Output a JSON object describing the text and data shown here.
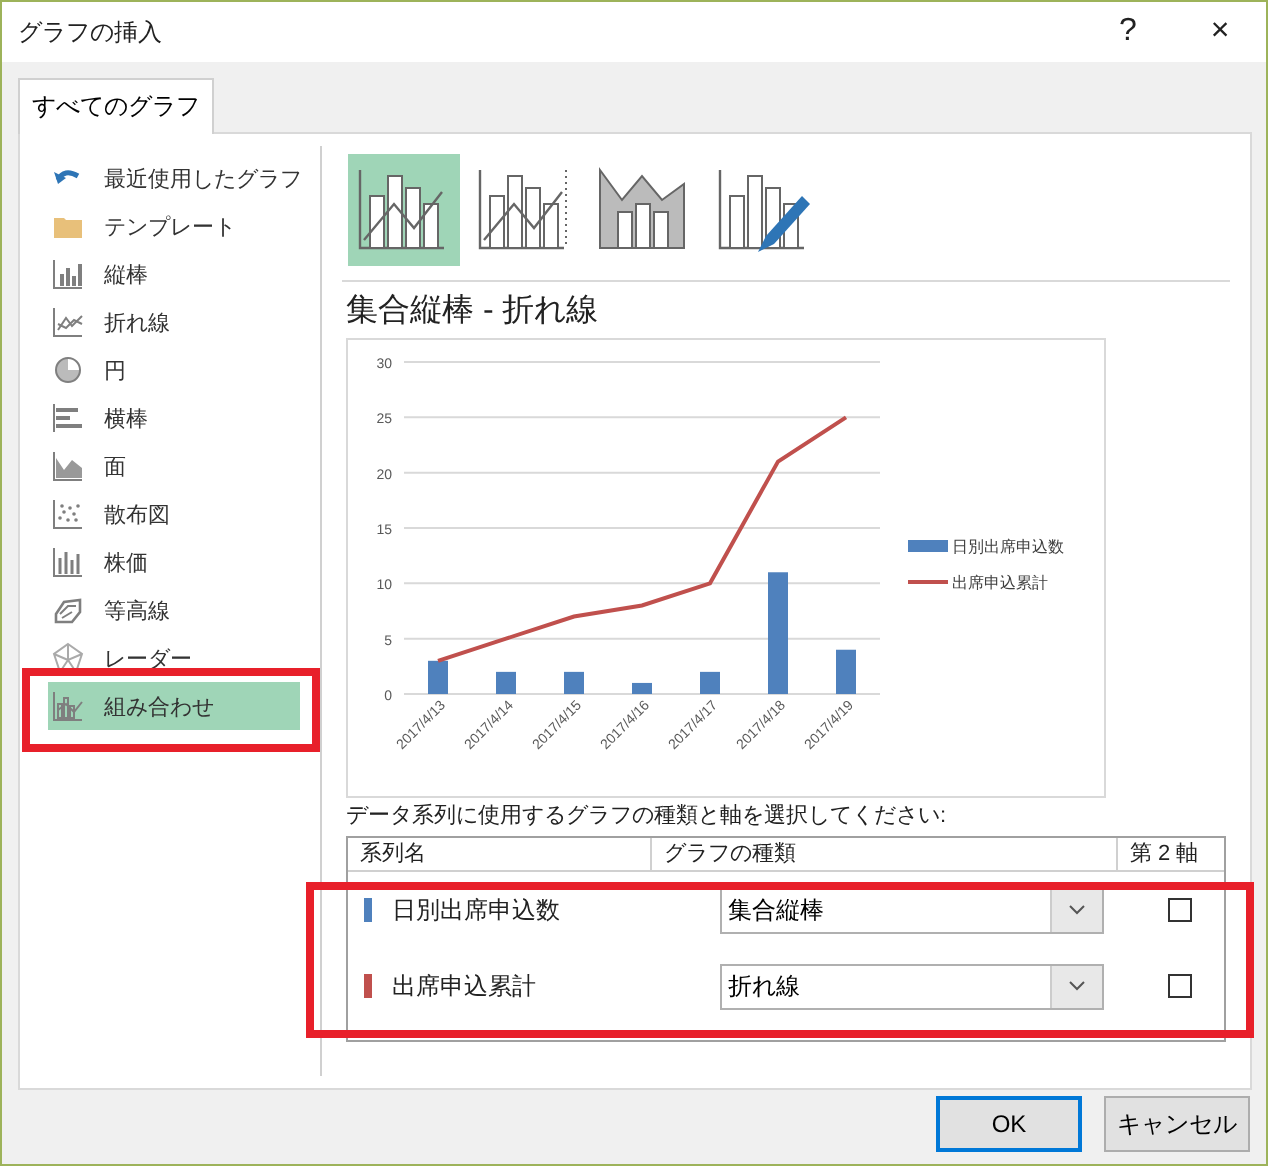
{
  "window": {
    "title": "グラフの挿入",
    "help": "?",
    "close": "×"
  },
  "tabs": [
    {
      "label": "すべてのグラフ",
      "selected": true
    }
  ],
  "sidebar": {
    "items": [
      {
        "label": "最近使用したグラフ",
        "selected": false
      },
      {
        "label": "テンプレート",
        "selected": false
      },
      {
        "label": "縦棒",
        "selected": false
      },
      {
        "label": "折れ線",
        "selected": false
      },
      {
        "label": "円",
        "selected": false
      },
      {
        "label": "横棒",
        "selected": false
      },
      {
        "label": "面",
        "selected": false
      },
      {
        "label": "散布図",
        "selected": false
      },
      {
        "label": "株価",
        "selected": false
      },
      {
        "label": "等高線",
        "selected": false
      },
      {
        "label": "レーダー",
        "selected": false
      },
      {
        "label": "組み合わせ",
        "selected": true
      }
    ]
  },
  "subtypes": [
    {
      "selected": true
    },
    {
      "selected": false
    },
    {
      "selected": false
    },
    {
      "selected": false
    }
  ],
  "preview_title": "集合縦棒 - 折れ線",
  "preview": {
    "chart_data": {
      "type": "bar",
      "categories": [
        "2017/4/13",
        "2017/4/14",
        "2017/4/15",
        "2017/4/16",
        "2017/4/17",
        "2017/4/18",
        "2017/4/19"
      ],
      "series": [
        {
          "name": "日別出席申込数",
          "color": "#4f81bd",
          "values": [
            3,
            2,
            2,
            1,
            2,
            11,
            4
          ]
        },
        {
          "name": "出席申込累計",
          "color": "#c0504d",
          "type": "line",
          "values": [
            3,
            5,
            7,
            8,
            10,
            21,
            25
          ]
        }
      ],
      "grid": true,
      "legend": true,
      "ylim": [
        0,
        30
      ],
      "yticks": [
        0,
        5,
        10,
        15,
        20,
        25,
        30
      ]
    }
  },
  "series_prompt": "データ系列に使用するグラフの種類と軸を選択してください:",
  "series_table": {
    "columns": [
      "系列名",
      "グラフの種類",
      "第 2 軸"
    ],
    "rows": [
      {
        "name": "日別出席申込数",
        "color": "#4f81bd",
        "chart_type": "集合縦棒",
        "secondary_axis": false
      },
      {
        "name": "出席申込累計",
        "color": "#c0504d",
        "chart_type": "折れ線",
        "secondary_axis": false
      }
    ]
  },
  "buttons": [
    {
      "label": "OK",
      "kind": "default"
    },
    {
      "label": "キャンセル",
      "kind": "normal"
    }
  ]
}
